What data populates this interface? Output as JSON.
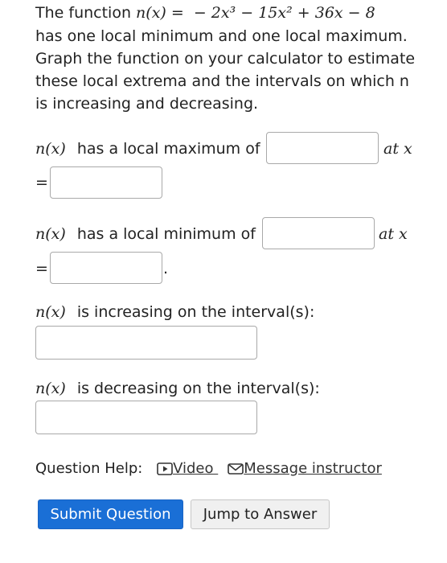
{
  "question": {
    "line1_prefix": "The function",
    "function_lhs": "n(x) =",
    "function_rhs": "− 2x³ − 15x² + 36x − 8",
    "line2": "has one local minimum and one local maximum.",
    "line3": "Graph the function on your calculator to estimate",
    "line4": "these local extrema and the intervals on which n",
    "line5": "is increasing and decreasing."
  },
  "max_row": {
    "math": "n(x)",
    "text": "has a local maximum of",
    "at": "at x",
    "eq": "=",
    "value_input": "",
    "x_input": ""
  },
  "min_row": {
    "math": "n(x)",
    "text": "has a local minimum of",
    "at": "at x",
    "eq": "=",
    "value_input": "",
    "x_input": "",
    "trailing": "."
  },
  "increasing": {
    "math": "n(x)",
    "text": "is increasing on the interval(s):",
    "input": ""
  },
  "decreasing": {
    "math": "n(x)",
    "text": "is decreasing on the interval(s):",
    "input": ""
  },
  "help": {
    "label": "Question Help:",
    "video_label": "Video",
    "video_icon": "play-icon",
    "message_label": "Message instructor",
    "message_icon": "envelope-icon"
  },
  "buttons": {
    "submit": "Submit Question",
    "jump": "Jump to Answer"
  },
  "colors": {
    "primary_button": "#1a6fd6",
    "secondary_button": "#f0f0f0",
    "input_border": "#a9a9a9"
  }
}
